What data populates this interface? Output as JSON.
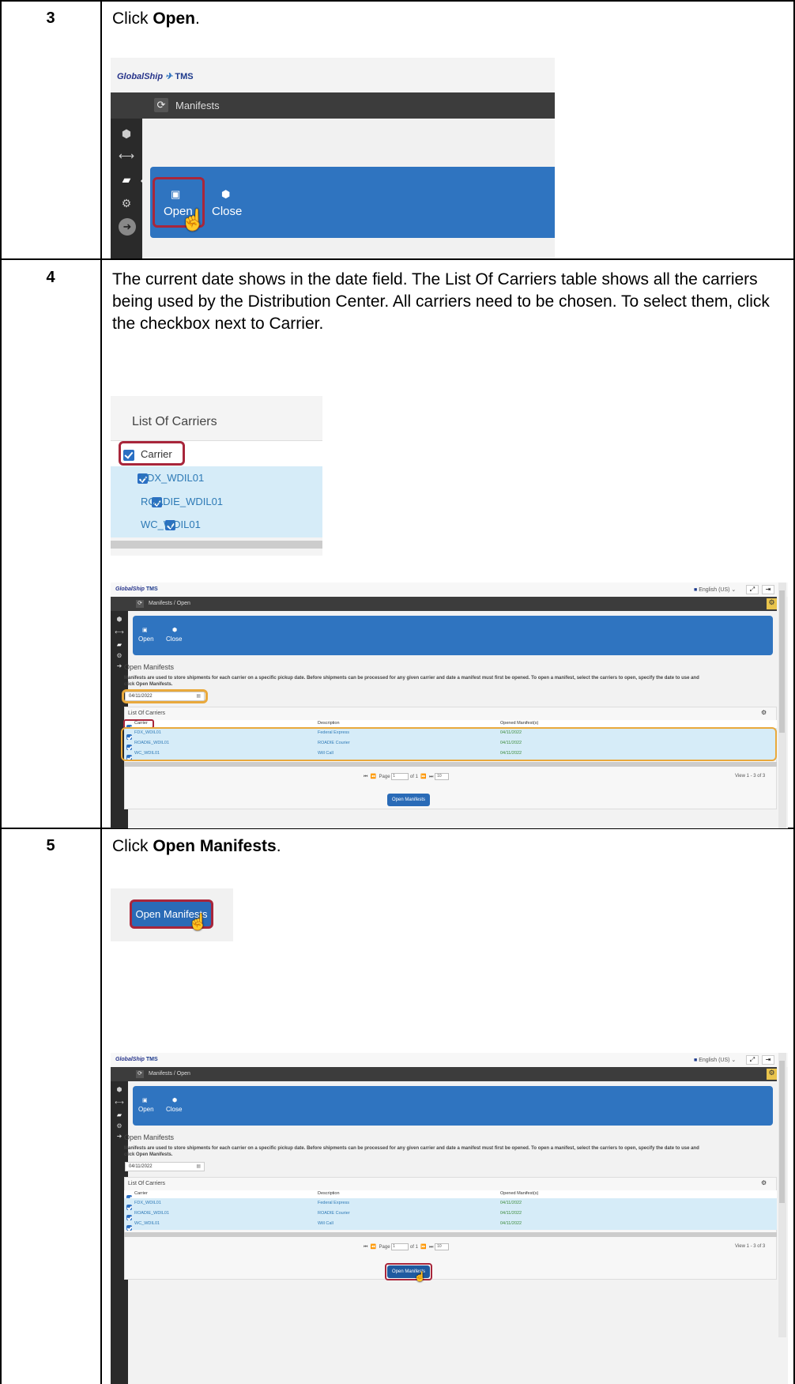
{
  "steps": [
    {
      "number": "3",
      "text_parts": [
        "Click ",
        "Open",
        "."
      ]
    },
    {
      "number": "4",
      "text": "The current date shows in the date field. The List Of Carriers table shows all the carriers being used by the Distribution Center. All carriers need to be chosen. To select them, click the checkbox next to Carrier."
    },
    {
      "number": "5",
      "text_parts": [
        "Click ",
        "Open Manifests",
        "."
      ]
    }
  ],
  "app": {
    "logo_text": "GlobalShip",
    "logo_suffix": "TMS",
    "section_title": "Manifests",
    "breadcrumb": "Manifests / Open",
    "language": "English (US)",
    "open_label": "Open",
    "close_label": "Close",
    "page_title": "Open Manifests",
    "instructions": "Manifests are used to store shipments for each carrier on a specific pickup date. Before shipments can be processed for any given carrier and date a manifest must first be opened. To open a manifest, select the carriers to open, specify the date to use and click Open Manifests.",
    "date_value": "04/11/2022",
    "carriers_title": "List Of Carriers",
    "columns": [
      "Carrier",
      "Description",
      "Opened Manifest(s)"
    ],
    "rows": [
      [
        "FDX_WDIL01",
        "Federal Express",
        "04/11/2022"
      ],
      [
        "ROADIE_WDIL01",
        "ROADIE Courier",
        "04/11/2022"
      ],
      [
        "WC_WDIL01",
        "Will Call",
        "04/11/2022"
      ]
    ],
    "pager_page": "Page",
    "pager_value": "1",
    "pager_of": "of 1",
    "pager_size": "10",
    "view_text": "View 1 - 3 of 3",
    "open_manifests_button": "Open Manifests"
  },
  "colors": {
    "accent_blue": "#2f74c0",
    "highlight_red": "#a8263b",
    "highlight_orange": "#e9a93c",
    "dark_bar": "#3c3c3c"
  }
}
